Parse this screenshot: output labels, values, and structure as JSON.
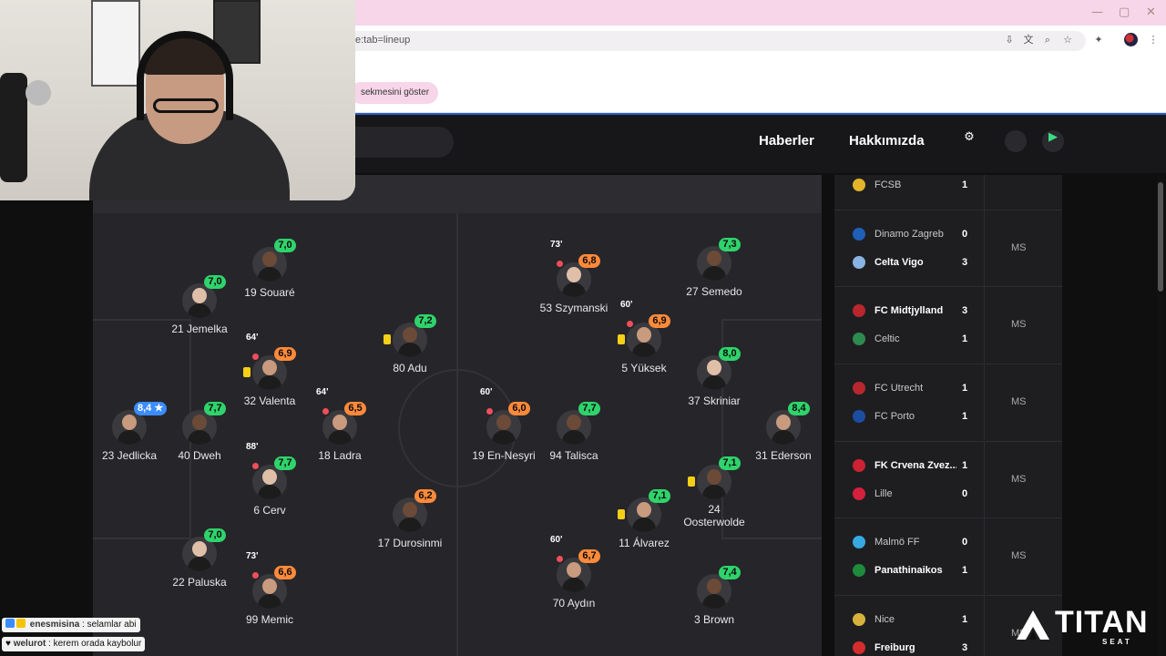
{
  "browser": {
    "url": "e:tab=lineup",
    "bookmark_chip": "sekmesini göster",
    "window_controls": [
      "—",
      "▢",
      "✕"
    ]
  },
  "nav": {
    "links": [
      "Haberler",
      "Hakkımızda"
    ],
    "icons": [
      "gear-icon",
      "apple-icon",
      "google-play-icon"
    ]
  },
  "lineup": {
    "players": [
      {
        "id": "souare",
        "name": "19 Souaré",
        "rating": "7,0",
        "rating_color": "green"
      },
      {
        "id": "jemelka",
        "name": "21 Jemelka",
        "rating": "7,0",
        "rating_color": "green"
      },
      {
        "id": "valenta",
        "name": "32 Valenta",
        "rating": "6,9",
        "rating_color": "orange",
        "sub_time": "64'",
        "yellow_card": true
      },
      {
        "id": "adu",
        "name": "80 Adu",
        "rating": "7,2",
        "rating_color": "green",
        "yellow_card": true
      },
      {
        "id": "jedlicka",
        "name": "23 Jedlicka",
        "rating": "8,4 ★",
        "rating_color": "blue"
      },
      {
        "id": "dweh",
        "name": "40 Dweh",
        "rating": "7,7",
        "rating_color": "green"
      },
      {
        "id": "ladra",
        "name": "18 Ladra",
        "rating": "6,5",
        "rating_color": "orange",
        "sub_time": "64'"
      },
      {
        "id": "cerv",
        "name": "6 Cerv",
        "rating": "7,7",
        "rating_color": "green",
        "sub_time": "88'"
      },
      {
        "id": "durosinmi",
        "name": "17 Durosinmi",
        "rating": "6,2",
        "rating_color": "orange"
      },
      {
        "id": "paluska",
        "name": "22 Paluska",
        "rating": "7,0",
        "rating_color": "green"
      },
      {
        "id": "memic",
        "name": "99 Memic",
        "rating": "6,6",
        "rating_color": "orange",
        "sub_time": "73'"
      },
      {
        "id": "szymanski",
        "name": "53 Szymanski",
        "rating": "6,8",
        "rating_color": "orange",
        "sub_time": "73'"
      },
      {
        "id": "semedo",
        "name": "27 Semedo",
        "rating": "7,3",
        "rating_color": "green"
      },
      {
        "id": "yuksek",
        "name": "5 Yüksek",
        "rating": "6,9",
        "rating_color": "orange",
        "sub_time": "60'",
        "yellow_card": true
      },
      {
        "id": "skriniar",
        "name": "37 Skriniar",
        "rating": "8,0",
        "rating_color": "green"
      },
      {
        "id": "en-nesyri",
        "name": "19 En-Nesyri",
        "rating": "6,0",
        "rating_color": "orange",
        "sub_time": "60'"
      },
      {
        "id": "talisca",
        "name": "94 Talisca",
        "rating": "7,7",
        "rating_color": "green"
      },
      {
        "id": "ederson",
        "name": "31 Ederson",
        "rating": "8,4",
        "rating_color": "green"
      },
      {
        "id": "oosterwolde",
        "name": "24\nOosterwolde",
        "rating": "7,1",
        "rating_color": "green",
        "yellow_card": true
      },
      {
        "id": "alvarez",
        "name": "11 Álvarez",
        "rating": "7,1",
        "rating_color": "green",
        "yellow_card": true
      },
      {
        "id": "aydin",
        "name": "70 Aydın",
        "rating": "6,7",
        "rating_color": "orange",
        "sub_time": "60'"
      },
      {
        "id": "brown",
        "name": "3 Brown",
        "rating": "7,4",
        "rating_color": "green"
      }
    ]
  },
  "fixtures": [
    {
      "home": {
        "name": "FCSB",
        "score": "1",
        "win": false
      },
      "away": null,
      "status": ""
    },
    {
      "home": {
        "name": "Dinamo Zagreb",
        "score": "0",
        "win": false
      },
      "away": {
        "name": "Celta Vigo",
        "score": "3",
        "win": true
      },
      "status": "MS"
    },
    {
      "home": {
        "name": "FC Midtjylland",
        "score": "3",
        "win": true
      },
      "away": {
        "name": "Celtic",
        "score": "1",
        "win": false
      },
      "status": "MS"
    },
    {
      "home": {
        "name": "FC Utrecht",
        "score": "1",
        "win": false
      },
      "away": {
        "name": "FC Porto",
        "score": "1",
        "win": false
      },
      "status": "MS"
    },
    {
      "home": {
        "name": "FK Crvena Zvez...",
        "score": "1",
        "win": true
      },
      "away": {
        "name": "Lille",
        "score": "0",
        "win": false
      },
      "status": "MS"
    },
    {
      "home": {
        "name": "Malmö FF",
        "score": "0",
        "win": false
      },
      "away": {
        "name": "Panathinaikos",
        "score": "1",
        "win": true
      },
      "status": "MS"
    },
    {
      "home": {
        "name": "Nice",
        "score": "1",
        "win": false
      },
      "away": {
        "name": "Freiburg",
        "score": "3",
        "win": true
      },
      "status": "MS"
    }
  ],
  "chat": [
    {
      "user": "enesmisina",
      "message": "selamlar abi"
    },
    {
      "user": "welurot",
      "message": "kerem orada kaybolur"
    }
  ],
  "watermark": {
    "brand": "TITAN",
    "sub": "SEAT"
  },
  "colors": {
    "rating_green": "#2fd36b",
    "rating_orange": "#ff8a3a",
    "rating_blue": "#3b8cff",
    "yellow_card": "#f5d016",
    "sub_off": "#ef4e5b"
  }
}
